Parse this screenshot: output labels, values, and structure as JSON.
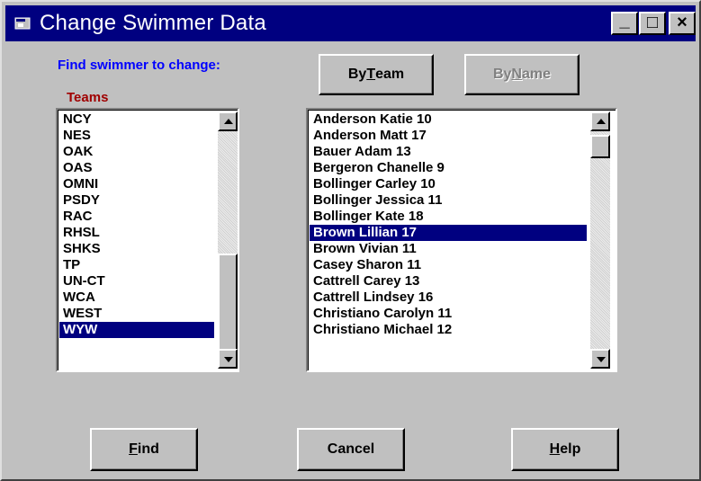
{
  "window": {
    "title": "Change Swimmer Data",
    "controls": {
      "minimize": "_",
      "maximize": "□",
      "close": "×"
    }
  },
  "labels": {
    "find": "Find swimmer to change:",
    "teams": "Teams"
  },
  "buttons": {
    "by_team": {
      "pre": "By ",
      "accel": "T",
      "post": "eam"
    },
    "by_name": {
      "pre": "By ",
      "accel": "N",
      "post": "ame"
    },
    "find": {
      "pre": "",
      "accel": "F",
      "post": "ind"
    },
    "cancel": {
      "label": "Cancel"
    },
    "help": {
      "pre": "",
      "accel": "H",
      "post": "elp"
    }
  },
  "teams": [
    "NCY",
    "NES",
    "OAK",
    "OAS",
    "OMNI",
    "PSDY",
    "RAC",
    "RHSL",
    "SHKS",
    "TP",
    "UN-CT",
    "WCA",
    "WEST",
    "WYW"
  ],
  "teams_selected": "WYW",
  "swimmers": [
    "Anderson Katie 10",
    "Anderson Matt 17",
    "Bauer Adam 13",
    "Bergeron Chanelle 9",
    "Bollinger Carley 10",
    "Bollinger Jessica 11",
    "Bollinger Kate 18",
    "Brown Lillian 17",
    "Brown Vivian 11",
    "Casey Sharon 11",
    "Cattrell Carey 13",
    "Cattrell Lindsey 16",
    "Christiano Carolyn 11",
    "Christiano Michael 12"
  ],
  "swimmers_selected": "Brown Lillian 17",
  "colors": {
    "titlebar": "#000080",
    "selection": "#000080",
    "find_label": "#0000ff",
    "teams_label": "#a00000",
    "face": "#c0c0c0"
  }
}
